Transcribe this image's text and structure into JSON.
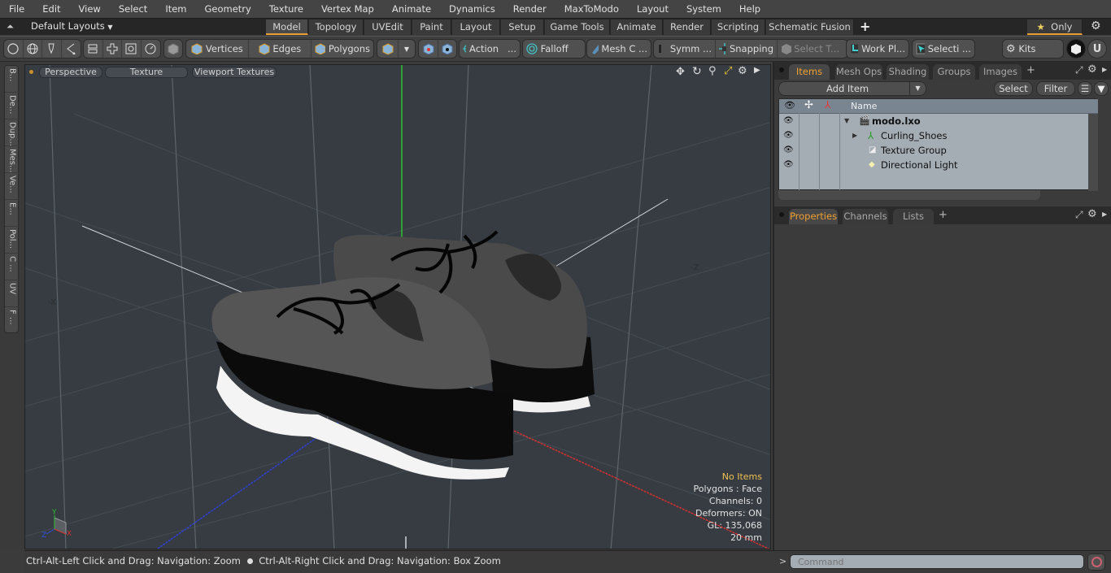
{
  "menu": [
    "File",
    "Edit",
    "View",
    "Select",
    "Item",
    "Geometry",
    "Texture",
    "Vertex Map",
    "Animate",
    "Dynamics",
    "Render",
    "MaxToModo",
    "Layout",
    "System",
    "Help"
  ],
  "layoutbar": {
    "layout_label": "Default Layouts",
    "tabs": [
      "Model",
      "Topology",
      "UVEdit",
      "Paint",
      "Layout",
      "Setup",
      "Game Tools",
      "Animate",
      "Render",
      "Scripting",
      "Schematic Fusion"
    ],
    "active_tab": "Model",
    "add_label": "+",
    "only_label": "Only"
  },
  "toolbar": {
    "vertices": "Vertices",
    "edges": "Edges",
    "polygons": "Polygons",
    "action": "Action",
    "falloff": "Falloff",
    "mesh_c": "Mesh C ...",
    "symm": "Symm ...",
    "snapping": "Snapping",
    "select_t": "Select T...",
    "work_pl": "Work Pl...",
    "selecti": "Selecti ...",
    "kits": "Kits",
    "ellipsis": "..."
  },
  "left_strip": [
    "B...",
    "De...",
    "Dup...",
    "Mes...",
    "Ve...",
    "E...",
    "Pol...",
    "C ...",
    "UV",
    "F ..."
  ],
  "viewport": {
    "view_label": "Perspective",
    "shading_label": "Texture",
    "textures_label": "Viewport Textures",
    "axis_neg_x": "-X",
    "axis_neg_z": "-Z",
    "gizmo": {
      "x": "X",
      "y": "Y",
      "z": "Z"
    },
    "hud": {
      "selection": "No Items",
      "polygons": "Polygons : Face",
      "channels": "Channels: 0",
      "deformers": "Deformers: ON",
      "gl": "GL: 135,068",
      "scale": "20 mm"
    }
  },
  "status": {
    "hint1": "Ctrl-Alt-Left Click and Drag: Navigation: Zoom",
    "hint2": "Ctrl-Alt-Right Click and Drag: Navigation: Box Zoom"
  },
  "items_panel": {
    "tabs": [
      "Items",
      "Mesh Ops",
      "Shading",
      "Groups",
      "Images"
    ],
    "active_tab": "Items",
    "add_item": "Add Item",
    "select": "Select",
    "filter": "Filter",
    "column_name": "Name",
    "tree": [
      {
        "name": "modo.lxo",
        "bold": true,
        "icon": "scene-icon"
      },
      {
        "name": "Curling_Shoes",
        "icon": "locator-icon"
      },
      {
        "name": "Texture Group",
        "icon": "texture-group-icon"
      },
      {
        "name": "Directional Light",
        "icon": "light-icon"
      }
    ]
  },
  "properties_panel": {
    "tabs": [
      "Properties",
      "Channels",
      "Lists"
    ],
    "active_tab": "Properties"
  },
  "command": {
    "prompt": ">",
    "placeholder": "Command"
  },
  "colors": {
    "accent": "#e8a030",
    "hud_highlight": "#f0c050",
    "axis_x": "#d03030",
    "axis_y": "#30c030",
    "axis_z": "#3040d0"
  }
}
